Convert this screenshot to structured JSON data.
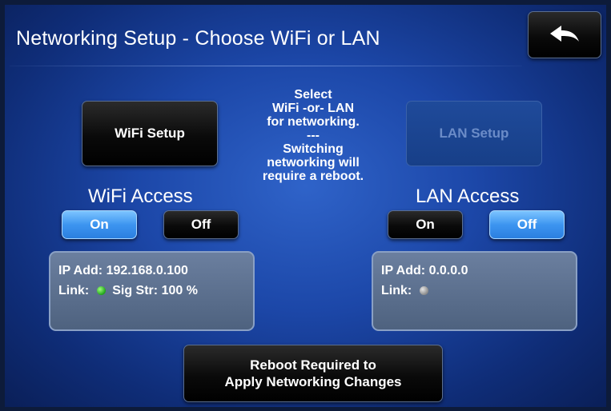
{
  "header": {
    "title": "Networking Setup - Choose WiFi or LAN"
  },
  "buttons": {
    "wifi_setup": "WiFi Setup",
    "lan_setup": "LAN Setup",
    "reboot": "Reboot Required to\nApply Networking Changes"
  },
  "center_note": "Select\nWiFi -or- LAN\nfor networking.\n---\nSwitching\nnetworking will\nrequire a reboot.",
  "wifi": {
    "title": "WiFi Access",
    "on_label": "On",
    "off_label": "Off",
    "selected": "On",
    "ip_label": "IP Add:",
    "ip_value": "192.168.0.100",
    "link_label": "Link:",
    "link_status": "green",
    "sig_label": "Sig Str:",
    "sig_value": "100 %"
  },
  "lan": {
    "title": "LAN Access",
    "on_label": "On",
    "off_label": "Off",
    "selected": "Off",
    "ip_label": "IP Add:",
    "ip_value": "0.0.0.0",
    "link_label": "Link:",
    "link_status": "grey"
  },
  "colors": {
    "background": "#1c47a8",
    "toggle_selected": "#3d95f0",
    "button_dark": "#0a0a0a",
    "link_ok": "#1fa21a",
    "link_off": "#8a8a8a"
  },
  "icons": {
    "back": "back-arrow-icon"
  }
}
